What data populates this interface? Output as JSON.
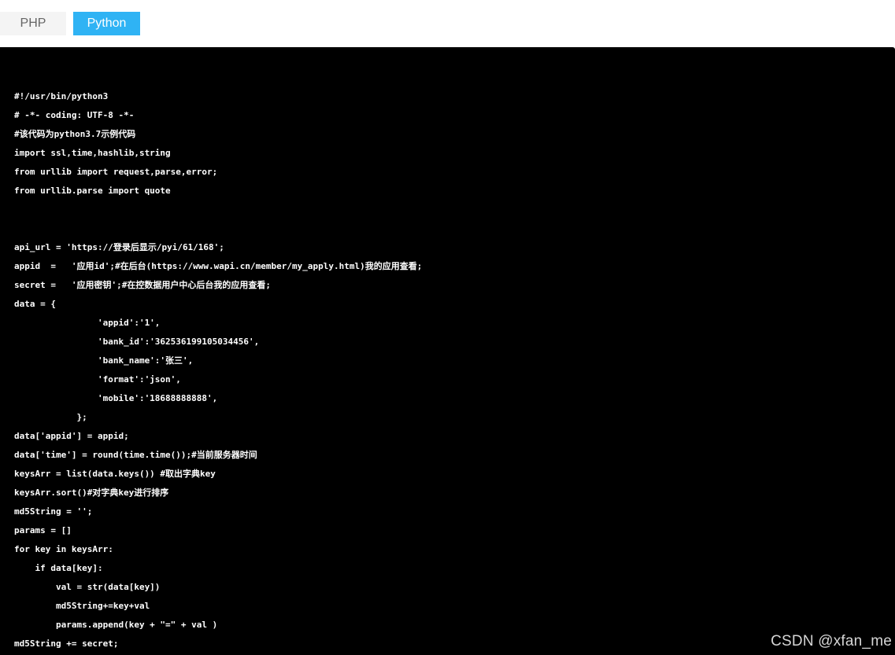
{
  "tabs": {
    "php_label": "PHP",
    "python_label": "Python",
    "active": "Python"
  },
  "code": {
    "language": "python",
    "lines": [
      "#!/usr/bin/python3",
      "# -*- coding: UTF-8 -*-",
      "#该代码为python3.7示例代码",
      "import ssl,time,hashlib,string",
      "from urllib import request,parse,error;",
      "from urllib.parse import quote",
      "",
      "",
      "api_url = 'https://登录后显示/pyi/61/168';",
      "appid  =   '应用id';#在后台(https://www.wapi.cn/member/my_apply.html)我的应用查看;",
      "secret =   '应用密钥';#在控数据用户中心后台我的应用查看;",
      "data = {",
      "                'appid':'1',",
      "                'bank_id':'362536199105034456',",
      "                'bank_name':'张三',",
      "                'format':'json',",
      "                'mobile':'18688888888',",
      "            };",
      "data['appid'] = appid;",
      "data['time'] = round(time.time());#当前服务器时间",
      "keysArr = list(data.keys()) #取出字典key",
      "keysArr.sort()#对字典key进行排序",
      "md5String = '';",
      "params = []",
      "for key in keysArr:",
      "    if data[key]:",
      "        val = str(data[key])",
      "        md5String+=key+val",
      "        params.append(key + \"=\" + val )",
      "md5String += secret;"
    ]
  },
  "watermark": "CSDN @xfan_me",
  "colors": {
    "tab_active_bg": "#2fb3f4",
    "tab_inactive_bg": "#f4f4f4",
    "code_bg": "#000000",
    "code_text": "#ffffff"
  }
}
